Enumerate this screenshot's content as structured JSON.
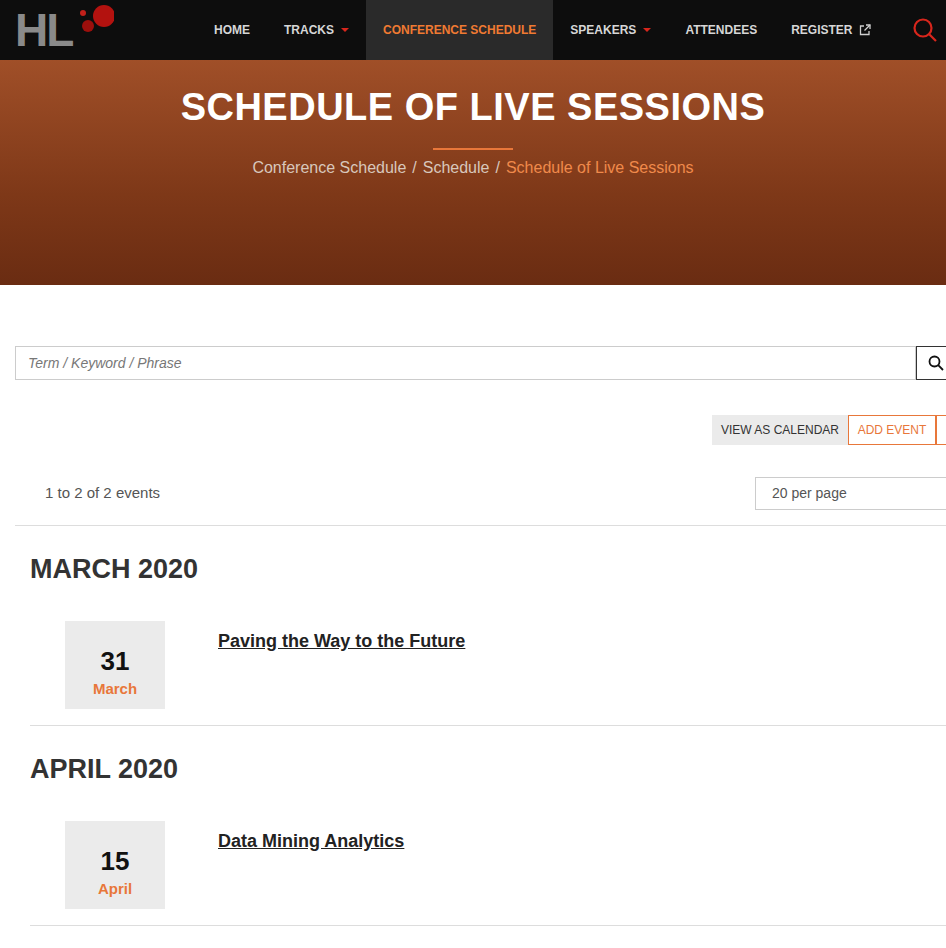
{
  "logo": {
    "text": "HL"
  },
  "nav": {
    "items": [
      {
        "label": "HOME",
        "kind": "link",
        "selected": false
      },
      {
        "label": "TRACKS",
        "kind": "dropdown",
        "selected": false
      },
      {
        "label": "CONFERENCE SCHEDULE",
        "kind": "link",
        "selected": true
      },
      {
        "label": "SPEAKERS",
        "kind": "dropdown",
        "selected": false
      },
      {
        "label": "ATTENDEES",
        "kind": "link",
        "selected": false
      },
      {
        "label": "REGISTER",
        "kind": "external",
        "selected": false
      }
    ]
  },
  "hero": {
    "title": "SCHEDULE OF LIVE SESSIONS",
    "separator": "/",
    "breadcrumb": [
      {
        "label": "Conference Schedule",
        "selected": false
      },
      {
        "label": "Schedule",
        "selected": false
      },
      {
        "label": "Schedule of Live Sessions",
        "selected": true
      }
    ]
  },
  "search": {
    "placeholder": "Term / Keyword / Phrase"
  },
  "actions": [
    {
      "label": "VIEW AS CALENDAR",
      "kind": "secondary"
    },
    {
      "label": "ADD EVENT",
      "kind": "outline"
    }
  ],
  "results": {
    "count": "1 to 2 of 2 events",
    "per_page": "20 per page"
  },
  "months": [
    {
      "title": "MARCH 2020",
      "events": [
        {
          "day": "31",
          "month": "March",
          "title": "Paving the Way to the Future"
        }
      ]
    },
    {
      "title": "APRIL 2020",
      "events": [
        {
          "day": "15",
          "month": "April",
          "title": "Data Mining Analytics"
        }
      ]
    }
  ]
}
